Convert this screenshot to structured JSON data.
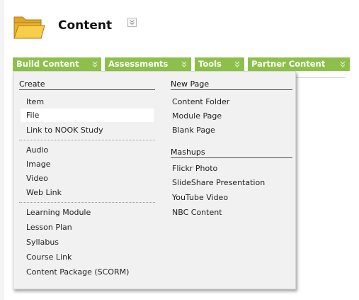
{
  "header": {
    "title": "Content",
    "title_menu_icon": "double-chevron-down-icon"
  },
  "menubar": {
    "tabs": [
      {
        "label": "Build Content"
      },
      {
        "label": "Assessments"
      },
      {
        "label": "Tools"
      },
      {
        "label": "Partner Content"
      }
    ]
  },
  "dropdown": {
    "left": {
      "heading": "Create",
      "groups": [
        [
          "Item",
          "File",
          "Link to NOOK Study"
        ],
        [
          "Audio",
          "Image",
          "Video",
          "Web Link"
        ],
        [
          "Learning Module",
          "Lesson Plan",
          "Syllabus",
          "Course Link",
          "Content Package (SCORM)"
        ]
      ],
      "highlighted": "File"
    },
    "right": {
      "heading": "New Page",
      "items": [
        "Content Folder",
        "Module Page",
        "Blank Page"
      ],
      "heading2": "Mashups",
      "items2": [
        "Flickr Photo",
        "SlideShare Presentation",
        "YouTube Video",
        "NBC Content"
      ]
    }
  },
  "colors": {
    "menubar_green": "#8dc04a",
    "folder_yellow": "#f3c23b",
    "dropdown_bg": "#f1f1f1"
  }
}
